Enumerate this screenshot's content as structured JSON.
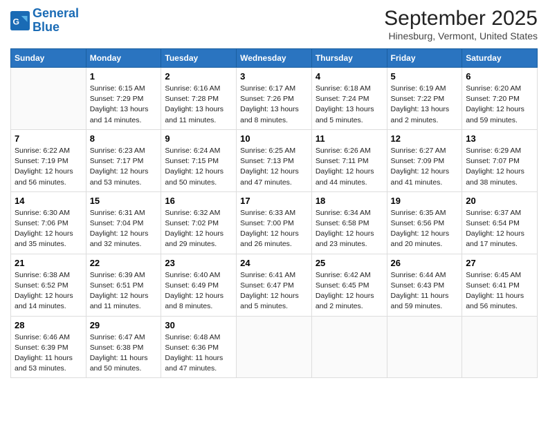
{
  "header": {
    "logo_line1": "General",
    "logo_line2": "Blue",
    "month": "September 2025",
    "location": "Hinesburg, Vermont, United States"
  },
  "weekdays": [
    "Sunday",
    "Monday",
    "Tuesday",
    "Wednesday",
    "Thursday",
    "Friday",
    "Saturday"
  ],
  "weeks": [
    [
      {
        "day": "",
        "text": ""
      },
      {
        "day": "1",
        "text": "Sunrise: 6:15 AM\nSunset: 7:29 PM\nDaylight: 13 hours\nand 14 minutes."
      },
      {
        "day": "2",
        "text": "Sunrise: 6:16 AM\nSunset: 7:28 PM\nDaylight: 13 hours\nand 11 minutes."
      },
      {
        "day": "3",
        "text": "Sunrise: 6:17 AM\nSunset: 7:26 PM\nDaylight: 13 hours\nand 8 minutes."
      },
      {
        "day": "4",
        "text": "Sunrise: 6:18 AM\nSunset: 7:24 PM\nDaylight: 13 hours\nand 5 minutes."
      },
      {
        "day": "5",
        "text": "Sunrise: 6:19 AM\nSunset: 7:22 PM\nDaylight: 13 hours\nand 2 minutes."
      },
      {
        "day": "6",
        "text": "Sunrise: 6:20 AM\nSunset: 7:20 PM\nDaylight: 12 hours\nand 59 minutes."
      }
    ],
    [
      {
        "day": "7",
        "text": "Sunrise: 6:22 AM\nSunset: 7:19 PM\nDaylight: 12 hours\nand 56 minutes."
      },
      {
        "day": "8",
        "text": "Sunrise: 6:23 AM\nSunset: 7:17 PM\nDaylight: 12 hours\nand 53 minutes."
      },
      {
        "day": "9",
        "text": "Sunrise: 6:24 AM\nSunset: 7:15 PM\nDaylight: 12 hours\nand 50 minutes."
      },
      {
        "day": "10",
        "text": "Sunrise: 6:25 AM\nSunset: 7:13 PM\nDaylight: 12 hours\nand 47 minutes."
      },
      {
        "day": "11",
        "text": "Sunrise: 6:26 AM\nSunset: 7:11 PM\nDaylight: 12 hours\nand 44 minutes."
      },
      {
        "day": "12",
        "text": "Sunrise: 6:27 AM\nSunset: 7:09 PM\nDaylight: 12 hours\nand 41 minutes."
      },
      {
        "day": "13",
        "text": "Sunrise: 6:29 AM\nSunset: 7:07 PM\nDaylight: 12 hours\nand 38 minutes."
      }
    ],
    [
      {
        "day": "14",
        "text": "Sunrise: 6:30 AM\nSunset: 7:06 PM\nDaylight: 12 hours\nand 35 minutes."
      },
      {
        "day": "15",
        "text": "Sunrise: 6:31 AM\nSunset: 7:04 PM\nDaylight: 12 hours\nand 32 minutes."
      },
      {
        "day": "16",
        "text": "Sunrise: 6:32 AM\nSunset: 7:02 PM\nDaylight: 12 hours\nand 29 minutes."
      },
      {
        "day": "17",
        "text": "Sunrise: 6:33 AM\nSunset: 7:00 PM\nDaylight: 12 hours\nand 26 minutes."
      },
      {
        "day": "18",
        "text": "Sunrise: 6:34 AM\nSunset: 6:58 PM\nDaylight: 12 hours\nand 23 minutes."
      },
      {
        "day": "19",
        "text": "Sunrise: 6:35 AM\nSunset: 6:56 PM\nDaylight: 12 hours\nand 20 minutes."
      },
      {
        "day": "20",
        "text": "Sunrise: 6:37 AM\nSunset: 6:54 PM\nDaylight: 12 hours\nand 17 minutes."
      }
    ],
    [
      {
        "day": "21",
        "text": "Sunrise: 6:38 AM\nSunset: 6:52 PM\nDaylight: 12 hours\nand 14 minutes."
      },
      {
        "day": "22",
        "text": "Sunrise: 6:39 AM\nSunset: 6:51 PM\nDaylight: 12 hours\nand 11 minutes."
      },
      {
        "day": "23",
        "text": "Sunrise: 6:40 AM\nSunset: 6:49 PM\nDaylight: 12 hours\nand 8 minutes."
      },
      {
        "day": "24",
        "text": "Sunrise: 6:41 AM\nSunset: 6:47 PM\nDaylight: 12 hours\nand 5 minutes."
      },
      {
        "day": "25",
        "text": "Sunrise: 6:42 AM\nSunset: 6:45 PM\nDaylight: 12 hours\nand 2 minutes."
      },
      {
        "day": "26",
        "text": "Sunrise: 6:44 AM\nSunset: 6:43 PM\nDaylight: 11 hours\nand 59 minutes."
      },
      {
        "day": "27",
        "text": "Sunrise: 6:45 AM\nSunset: 6:41 PM\nDaylight: 11 hours\nand 56 minutes."
      }
    ],
    [
      {
        "day": "28",
        "text": "Sunrise: 6:46 AM\nSunset: 6:39 PM\nDaylight: 11 hours\nand 53 minutes."
      },
      {
        "day": "29",
        "text": "Sunrise: 6:47 AM\nSunset: 6:38 PM\nDaylight: 11 hours\nand 50 minutes."
      },
      {
        "day": "30",
        "text": "Sunrise: 6:48 AM\nSunset: 6:36 PM\nDaylight: 11 hours\nand 47 minutes."
      },
      {
        "day": "",
        "text": ""
      },
      {
        "day": "",
        "text": ""
      },
      {
        "day": "",
        "text": ""
      },
      {
        "day": "",
        "text": ""
      }
    ]
  ]
}
